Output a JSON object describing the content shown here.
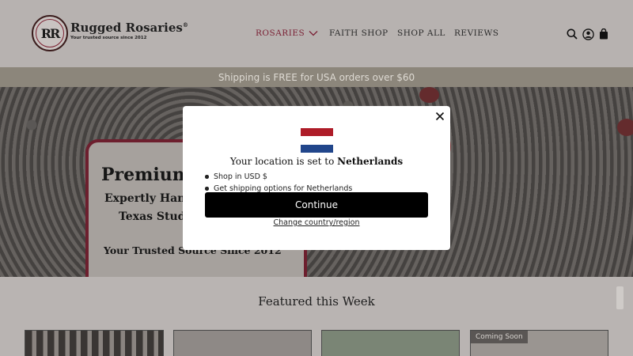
{
  "header": {
    "logo": {
      "mark": "RR",
      "name": "Rugged Rosaries",
      "trademark": "®",
      "tagline": "Your trusted source since 2012"
    },
    "nav": [
      {
        "label": "ROSARIES",
        "active": true,
        "has_dropdown": true
      },
      {
        "label": "FAITH SHOP"
      },
      {
        "label": "SHOP ALL"
      },
      {
        "label": "REVIEWS"
      }
    ],
    "icons": [
      "search-icon",
      "account-icon",
      "cart-icon"
    ],
    "accent_color": "#7a1f33"
  },
  "announcement": {
    "text": "Shipping is FREE for USA orders over $60"
  },
  "hero": {
    "title": "Premium",
    "subtitle_line1": "Expertly Han",
    "subtitle_line2": "Texas Stud",
    "since": "Your Trusted Source Since 2012"
  },
  "featured": {
    "title": "Featured this Week",
    "products": [
      {
        "badge": ""
      },
      {
        "badge": ""
      },
      {
        "badge": ""
      },
      {
        "badge": "Coming Soon"
      }
    ]
  },
  "modal": {
    "flag_colors": [
      "#ae1c28",
      "#ffffff",
      "#21468b"
    ],
    "location_prefix": "Your location is set to ",
    "country": "Netherlands",
    "bullets": [
      "Shop in USD $",
      "Get shipping options for Netherlands"
    ],
    "continue_label": "Continue",
    "change_label": "Change country/region"
  }
}
